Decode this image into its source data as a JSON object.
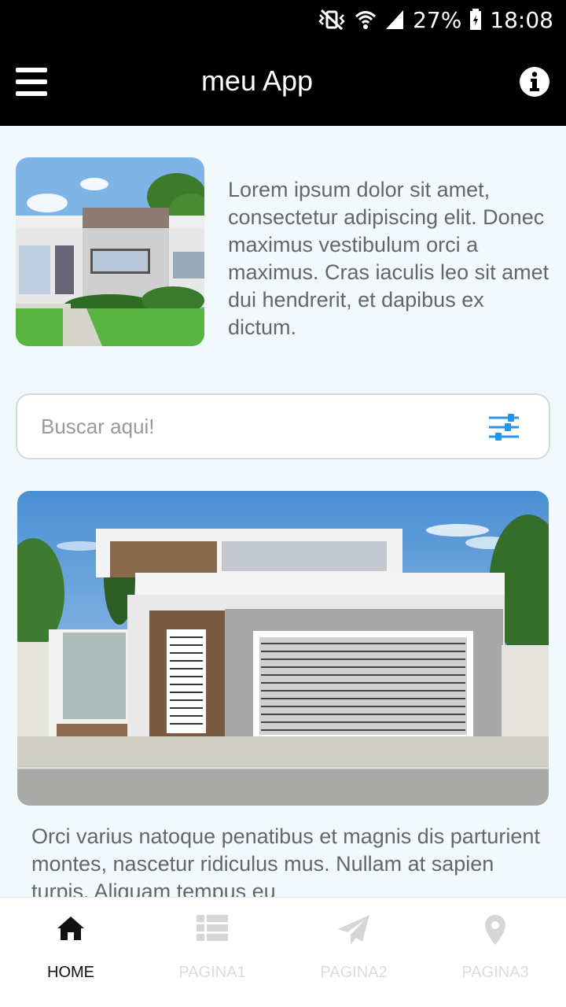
{
  "status_bar": {
    "battery": "27%",
    "time": "18:08"
  },
  "app_bar": {
    "title": "meu App",
    "menu_icon": "hamburger-menu-icon",
    "info_icon": "info-icon"
  },
  "intro": {
    "text": "Lorem ipsum dolor sit amet, consectetur adipiscing elit. Donec maximus vestibulum orci a maximus. Cras iaculis leo sit amet dui hendrerit, et dapibus ex dictum."
  },
  "search": {
    "placeholder": "Buscar aqui!",
    "value": "",
    "filter_icon": "sliders-filter-icon",
    "accent": "#2196f3"
  },
  "body": {
    "text": "Orci varius natoque penatibus et magnis dis parturient montes, nascetur ridiculus mus. Nullam at sapien turpis. Aliquam tempus eu"
  },
  "bottom_nav": {
    "items": [
      {
        "label": "HOME",
        "icon": "home-icon",
        "active": true
      },
      {
        "label": "PAGINA1",
        "icon": "list-icon",
        "active": false
      },
      {
        "label": "PAGINA2",
        "icon": "paper-plane-icon",
        "active": false
      },
      {
        "label": "PAGINA3",
        "icon": "map-pin-icon",
        "active": false
      }
    ]
  }
}
